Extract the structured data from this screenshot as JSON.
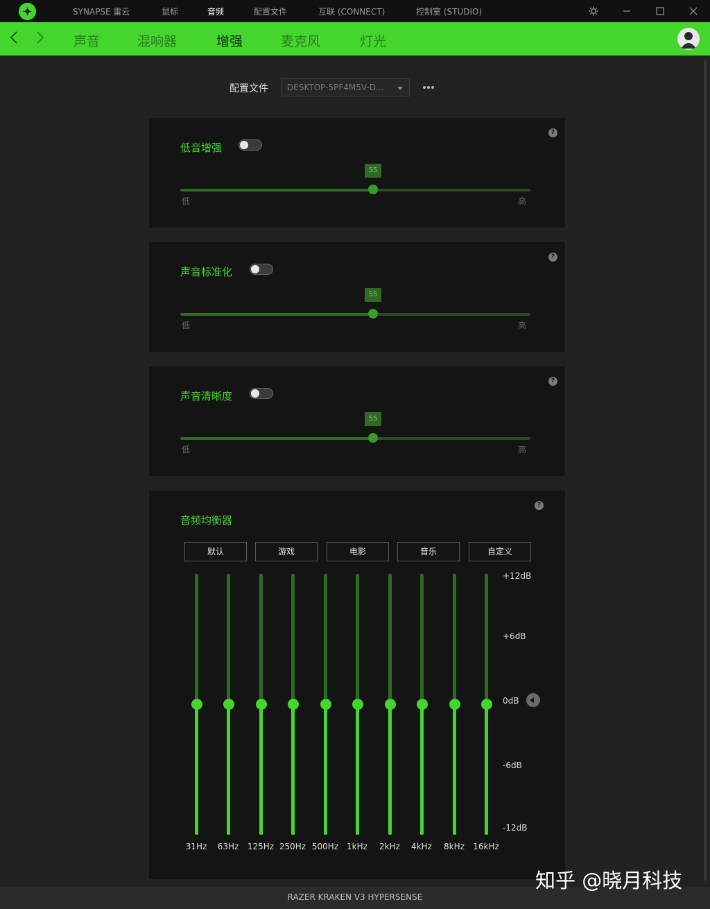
{
  "window": {
    "nav": [
      {
        "label": "SYNAPSE 雷云",
        "active": false
      },
      {
        "label": "鼠标",
        "active": false
      },
      {
        "label": "音频",
        "active": true
      },
      {
        "label": "配置文件",
        "active": false
      },
      {
        "label": "互联 (CONNECT)",
        "active": false
      },
      {
        "label": "控制室 (STUDIO)",
        "active": false
      }
    ],
    "icons": [
      "razer-logo-icon",
      "settings-icon",
      "minimize-icon",
      "maximize-icon",
      "close-icon"
    ]
  },
  "tabs": [
    {
      "label": "声音",
      "active": false
    },
    {
      "label": "混响器",
      "active": false
    },
    {
      "label": "增强",
      "active": true
    },
    {
      "label": "麦克风",
      "active": false
    },
    {
      "label": "灯光",
      "active": false
    }
  ],
  "profile": {
    "label": "配置文件",
    "value": "DESKTOP-5PF4M5V-D...",
    "more_icon": "more-icon"
  },
  "enhancements": [
    {
      "title": "低音增强",
      "enabled": false,
      "value": "55",
      "low": "低",
      "high": "高"
    },
    {
      "title": "声音标准化",
      "enabled": false,
      "value": "55",
      "low": "低",
      "high": "高"
    },
    {
      "title": "声音清晰度",
      "enabled": false,
      "value": "55",
      "low": "低",
      "high": "高"
    }
  ],
  "equalizer": {
    "title": "音频均衡器",
    "presets": [
      {
        "label": "默认",
        "active": true
      },
      {
        "label": "游戏",
        "active": false
      },
      {
        "label": "电影",
        "active": false
      },
      {
        "label": "音乐",
        "active": false
      },
      {
        "label": "自定义",
        "active": false
      }
    ],
    "db_labels": [
      "+12dB",
      "+6dB",
      "0dB",
      "-6dB",
      "-12dB"
    ],
    "db_range": [
      -12,
      12
    ],
    "bands": [
      {
        "freq": "31Hz",
        "gain_db": 0
      },
      {
        "freq": "63Hz",
        "gain_db": 0
      },
      {
        "freq": "125Hz",
        "gain_db": 0
      },
      {
        "freq": "250Hz",
        "gain_db": 0
      },
      {
        "freq": "500Hz",
        "gain_db": 0
      },
      {
        "freq": "1kHz",
        "gain_db": 0
      },
      {
        "freq": "2kHz",
        "gain_db": 0
      },
      {
        "freq": "4kHz",
        "gain_db": 0
      },
      {
        "freq": "8kHz",
        "gain_db": 0
      },
      {
        "freq": "16kHz",
        "gain_db": 0
      }
    ]
  },
  "footer": {
    "device": "RAZER KRAKEN V3 HYPERSENSE"
  },
  "watermark": "知乎 @晓月科技",
  "colors": {
    "accent": "#44d62c",
    "background": "#222222",
    "card": "#141414",
    "titlebar": "#111111"
  }
}
